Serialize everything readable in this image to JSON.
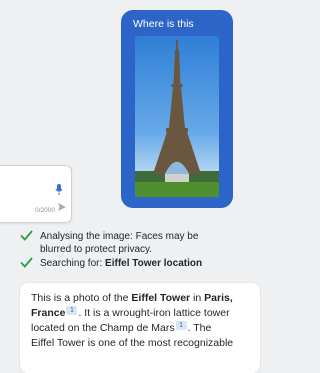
{
  "user_message": {
    "text": "Where is this"
  },
  "composer": {
    "char_count": "0/2000"
  },
  "status": [
    {
      "text": "Analysing the image: Faces may be blurred to protect privacy."
    },
    {
      "prefix": "Searching for: ",
      "query": "Eiffel Tower location"
    }
  ],
  "answer": {
    "t1": "This is a photo of the ",
    "b1": "Eiffel Tower",
    "t2": " in ",
    "b2": "Paris, France",
    "cite1": "1",
    "t3": ". It is a wrought-iron lattice tower located on the Champ de Mars",
    "cite2": "1",
    "t4": ". The Eiffel Tower is one of the most recognizable"
  },
  "colors": {
    "accent": "#2d64c8",
    "check": "#2e9f3e"
  }
}
